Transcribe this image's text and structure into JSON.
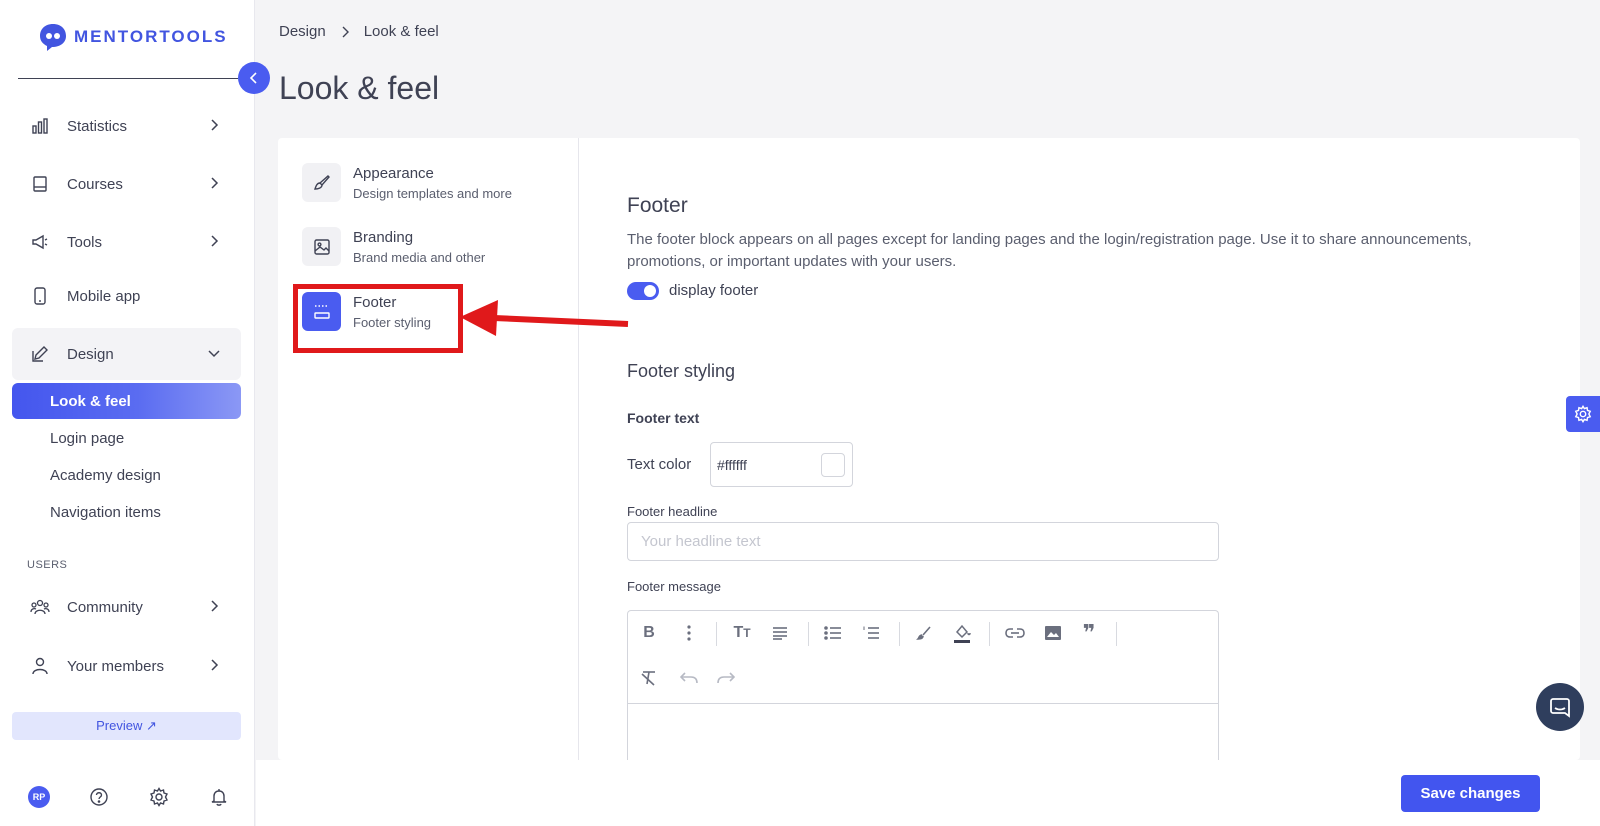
{
  "brand": {
    "name": "MENTORTOOLS",
    "accent": "#4a5cf0"
  },
  "sidebar": {
    "items": [
      {
        "label": "Statistics",
        "icon": "bar-chart-icon"
      },
      {
        "label": "Courses",
        "icon": "book-icon"
      },
      {
        "label": "Tools",
        "icon": "megaphone-icon"
      },
      {
        "label": "Mobile app",
        "icon": "phone-icon"
      },
      {
        "label": "Design",
        "icon": "edit-icon"
      }
    ],
    "design_subitems": [
      "Look & feel",
      "Login page",
      "Academy design",
      "Navigation items"
    ],
    "users_section_label": "USERS",
    "user_items": [
      {
        "label": "Community",
        "icon": "community-icon"
      },
      {
        "label": "Your members",
        "icon": "user-icon"
      }
    ],
    "preview_label": "Preview ↗",
    "avatar_initials": "RP"
  },
  "breadcrumb": {
    "parent": "Design",
    "current": "Look & feel"
  },
  "page_title": "Look & feel",
  "subnav": [
    {
      "title": "Appearance",
      "subtitle": "Design templates and more",
      "icon": "brush-icon"
    },
    {
      "title": "Branding",
      "subtitle": "Brand media and other",
      "icon": "image-icon"
    },
    {
      "title": "Footer",
      "subtitle": "Footer styling",
      "icon": "footer-icon"
    }
  ],
  "footer_section": {
    "title": "Footer",
    "description": "The footer block appears on all pages except for landing pages and the login/registration page. Use it to share announcements, promotions, or important updates with your users.",
    "toggle_label": "display footer",
    "toggle_on": true,
    "styling_title": "Footer styling",
    "footer_text_label": "Footer text",
    "text_color_label": "Text color",
    "text_color_value": "#ffffff",
    "headline_label": "Footer headline",
    "headline_placeholder": "Your headline text",
    "message_label": "Footer message"
  },
  "save_label": "Save changes"
}
